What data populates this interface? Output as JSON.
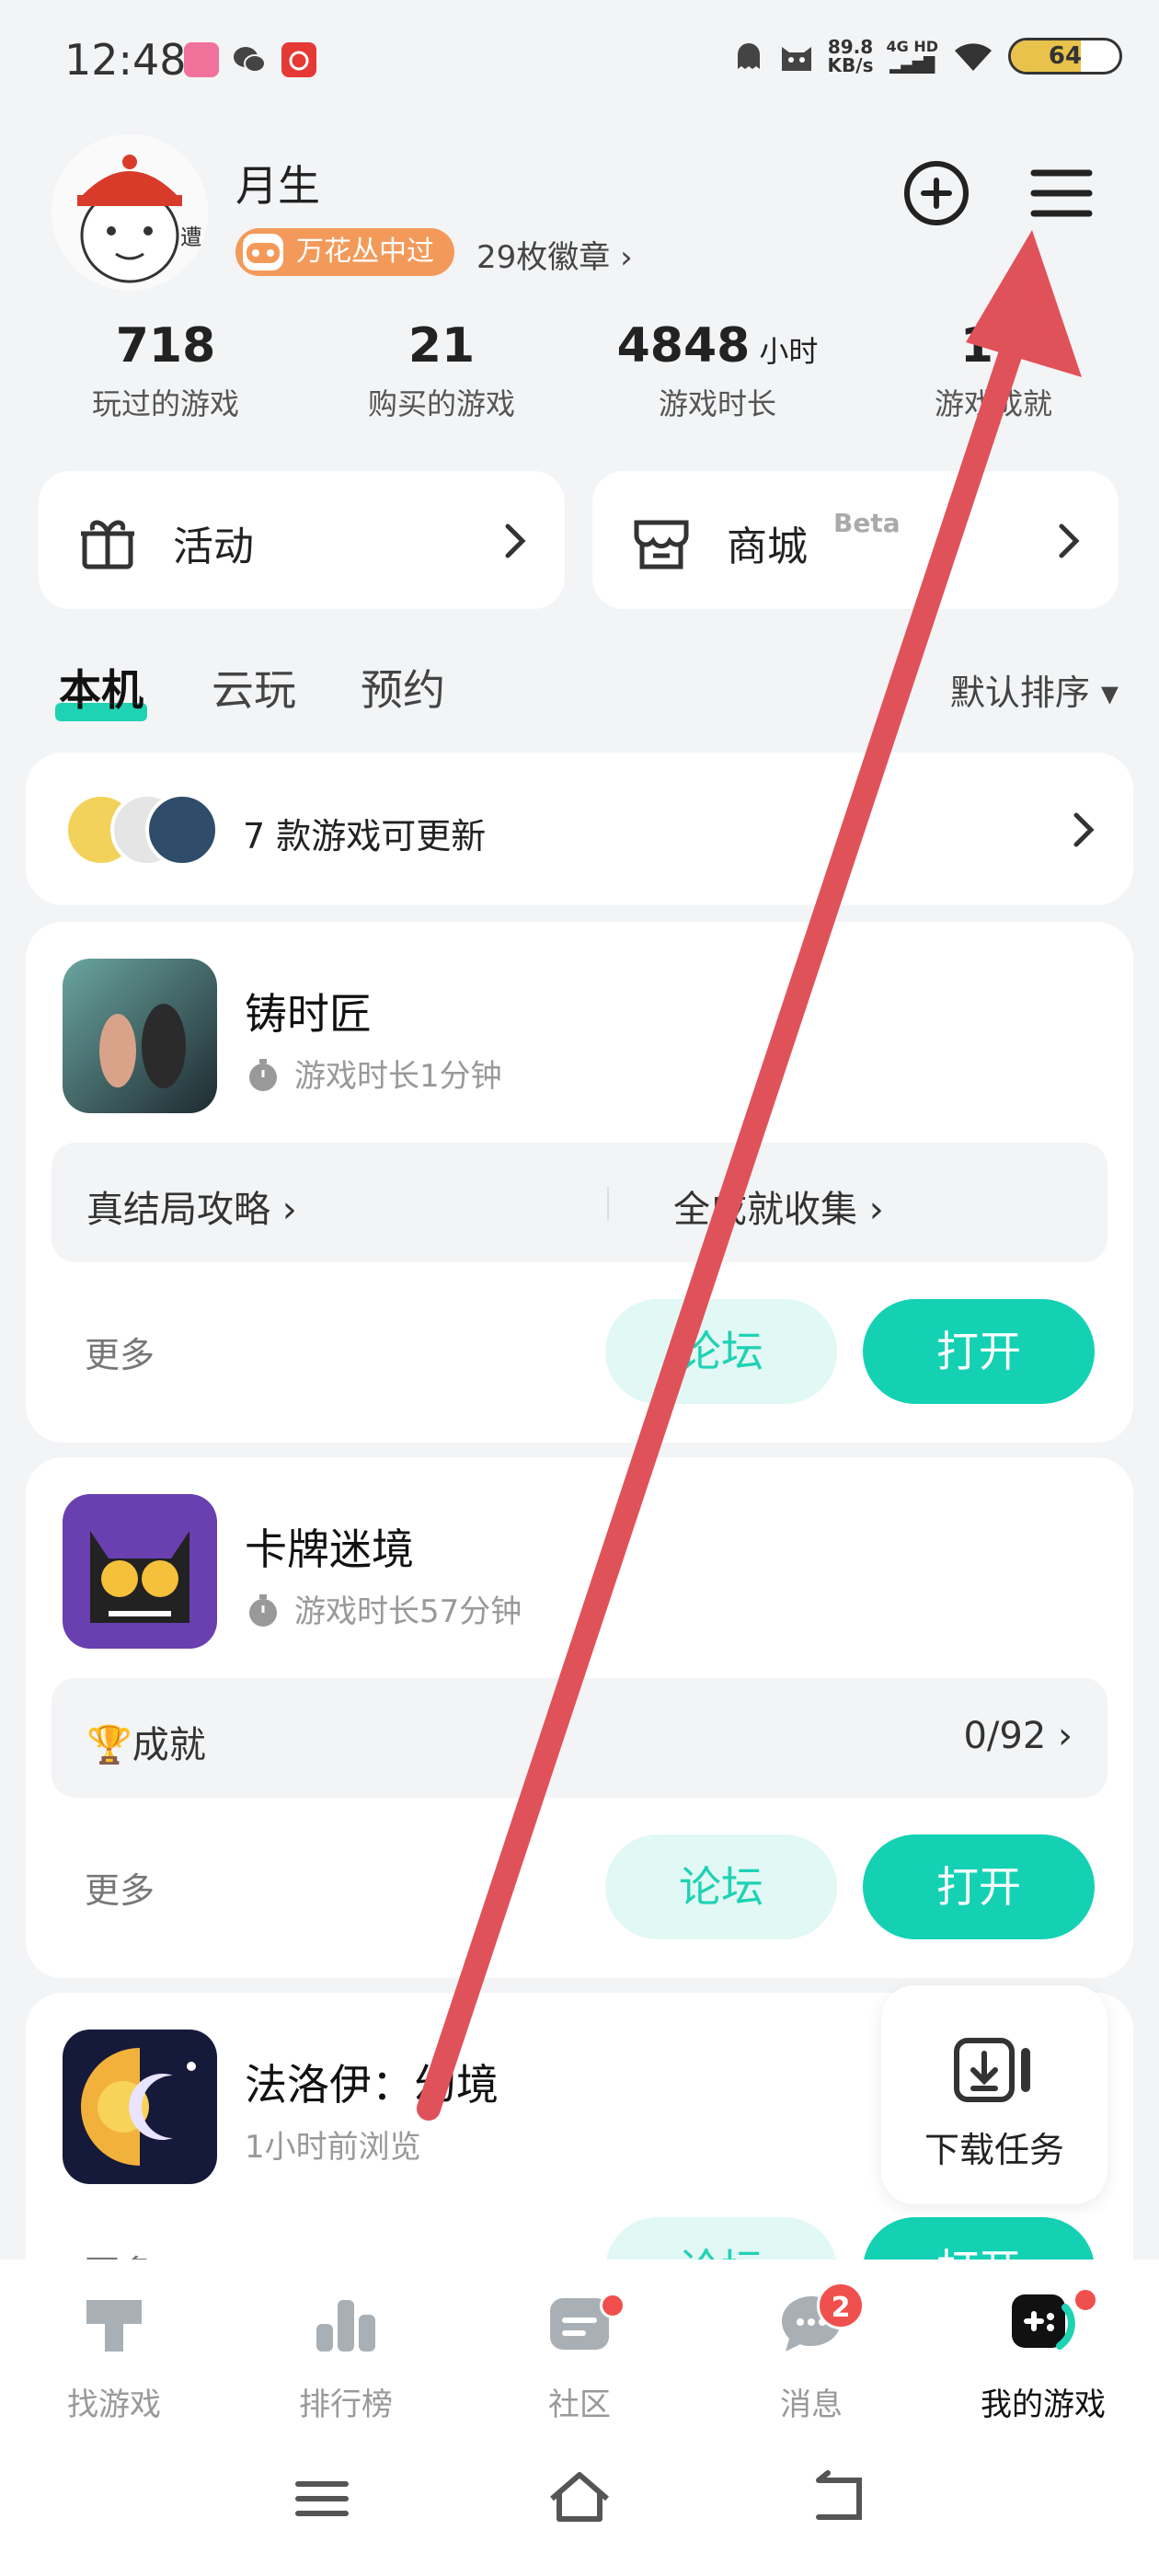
{
  "status_bar": {
    "time": "12:48",
    "net_speed": "89.8",
    "net_unit": "KB/s",
    "signal_top": "4G HD",
    "battery": "64",
    "battery_level": 0.64
  },
  "profile": {
    "username": "月生",
    "badge_label": "万花丛中过",
    "badge_count": "29枚徽章 ›"
  },
  "stats": [
    {
      "value": "718",
      "unit": "",
      "label": "玩过的游戏"
    },
    {
      "value": "21",
      "unit": "",
      "label": "购买的游戏"
    },
    {
      "value": "4848",
      "unit": "小时",
      "label": "游戏时长"
    },
    {
      "value": "17",
      "unit": "",
      "label": "游戏成就"
    }
  ],
  "quick": {
    "activity": "活动",
    "mall": "商城",
    "mall_tag": "Beta"
  },
  "tabs": {
    "local": "本机",
    "cloud": "云玩",
    "reserve": "预约",
    "sort": "默认排序 ▾"
  },
  "update_bar": {
    "text": "7 款游戏可更新"
  },
  "games": [
    {
      "title": "铸时匠",
      "sub": "游戏时长1分钟",
      "links": [
        "真结局攻略 ›",
        "全成就收集 ›"
      ],
      "more": "更多",
      "forum": "论坛",
      "open": "打开"
    },
    {
      "title": "卡牌迷境",
      "sub": "游戏时长57分钟",
      "achievement_label": "🏆成就",
      "achievement_value": "0/92 ›",
      "more": "更多",
      "forum": "论坛",
      "open": "打开"
    },
    {
      "title": "法洛伊：幻境",
      "sub": "1小时前浏览",
      "more": "更多",
      "forum": "论坛",
      "open": "打开"
    }
  ],
  "download": {
    "label": "下载任务"
  },
  "nav": {
    "find": "找游戏",
    "rank": "排行榜",
    "community": "社区",
    "messages": "消息",
    "messages_badge": "2",
    "mine": "我的游戏"
  },
  "colors": {
    "accent": "#14d1b4",
    "badge_orange": "#f39a5a",
    "alert_red": "#f0504d",
    "annotation_arrow": "#e0525a"
  }
}
